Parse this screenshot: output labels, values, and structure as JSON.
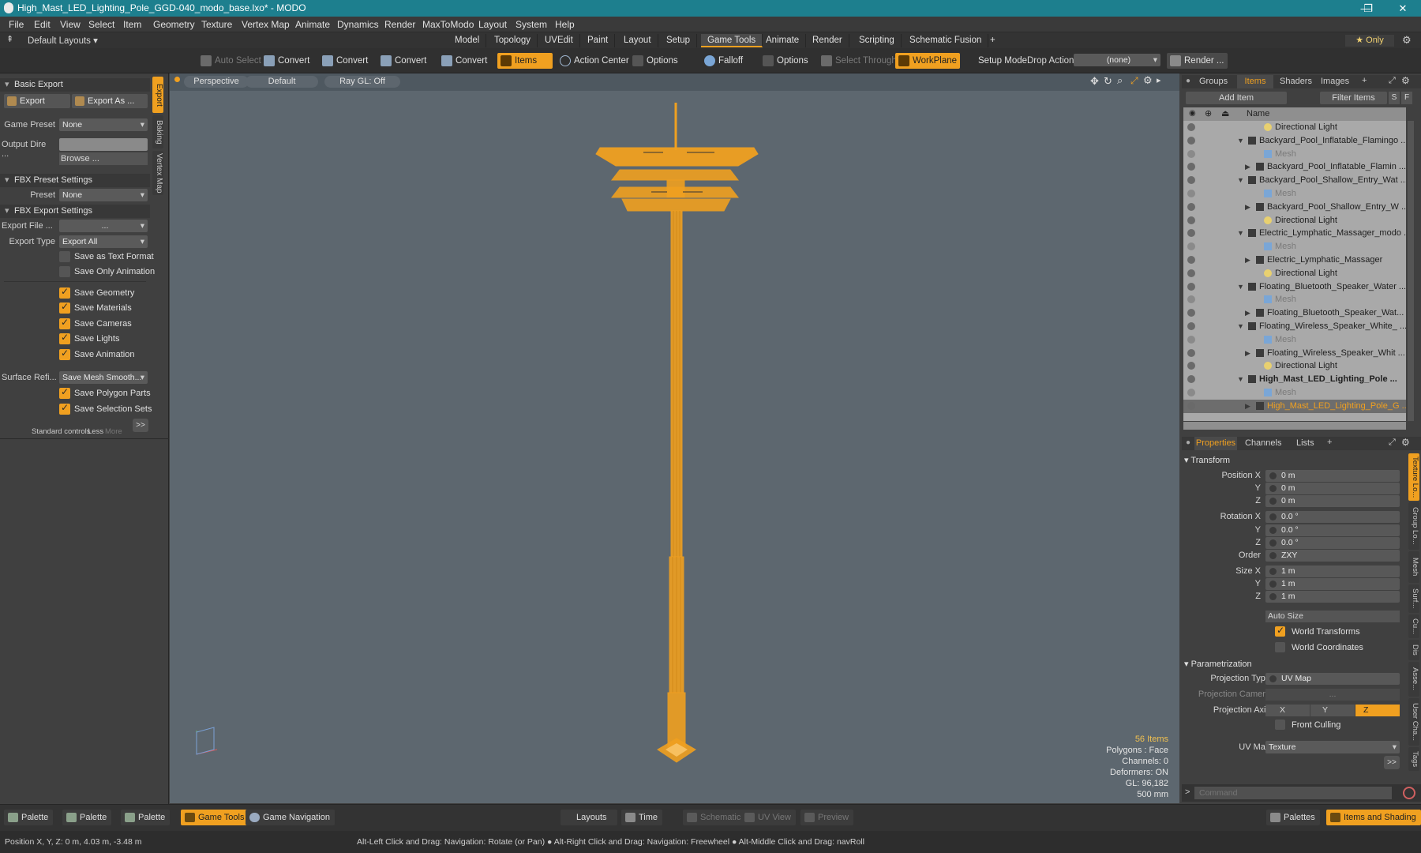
{
  "window": {
    "title": "High_Mast_LED_Lighting_Pole_GGD-040_modo_base.lxo* - MODO",
    "min": "—",
    "max": "❐",
    "close": "✕"
  },
  "menu": [
    "File",
    "Edit",
    "View",
    "Select",
    "Item",
    "Geometry",
    "Texture",
    "Vertex Map",
    "Animate",
    "Dynamics",
    "Render",
    "MaxToModo",
    "Layout",
    "System",
    "Help"
  ],
  "layouts_dropdown": "Default Layouts ▾",
  "tabs": [
    "Model",
    "Topology",
    "UVEdit",
    "Paint",
    "Layout",
    "Setup",
    "Game Tools",
    "Animate",
    "Render",
    "Scripting",
    "Schematic Fusion",
    "+"
  ],
  "active_tab": "Game Tools",
  "only_label": "★  Only",
  "toolbar": {
    "auto_select": "Auto Select",
    "convert1": "Convert",
    "convert2": "Convert",
    "convert3": "Convert",
    "convert4": "Convert",
    "items": "Items",
    "action_center": "Action Center",
    "options1": "Options",
    "falloff": "Falloff",
    "options2": "Options",
    "select_through": "Select Through",
    "workplane": "WorkPlane",
    "setup_mode": "Setup Mode",
    "drop_action": "Drop Action",
    "drop_value": "(none)",
    "render": "Render ..."
  },
  "left": {
    "basic_export": "Basic Export",
    "export_btn": "Export",
    "export_as_btn": "Export As ...",
    "game_preset_label": "Game Preset",
    "game_preset_value": "None",
    "output_dir_label": "Output Dire ...",
    "output_dir_value": "",
    "browse": "Browse ...",
    "fbx_preset_settings": "FBX Preset Settings",
    "preset_label": "Preset",
    "preset_value": "None",
    "fbx_export_settings": "FBX Export Settings",
    "export_file_label": "Export File  ...",
    "export_file_value": "...",
    "export_type_label": "Export Type",
    "export_type_value": "Export All",
    "save_as_text": "Save as Text Format",
    "save_only_anim": "Save Only Animation",
    "save_geometry": "Save Geometry",
    "save_materials": "Save Materials",
    "save_cameras": "Save Cameras",
    "save_lights": "Save Lights",
    "save_animation": "Save Animation",
    "surface_ref_label": "Surface Refi...",
    "surface_ref_value": "Save Mesh Smooth...",
    "save_polygon_parts": "Save Polygon Parts",
    "save_selection_sets": "Save Selection Sets",
    "standard_controls": "Standard controls",
    "less": "Less",
    "more": "More",
    "expand": ">>",
    "vtabs": [
      "Export",
      "Baking",
      "Vertex Map"
    ]
  },
  "viewport": {
    "view": "Perspective",
    "shading": "Default",
    "raygl": "Ray GL: Off",
    "stats": [
      "56 Items",
      "Polygons : Face",
      "Channels: 0",
      "Deformers: ON",
      "GL: 96,182",
      "500 mm"
    ]
  },
  "right": {
    "tabs": [
      "Groups",
      "Items",
      "Shaders",
      "Images"
    ],
    "add_item": "Add Item",
    "filter_items": "Filter Items",
    "col_name": "Name",
    "tree": [
      {
        "label": "Directional Light",
        "indent": 3,
        "type": "light"
      },
      {
        "label": "Backyard_Pool_Inflatable_Flamingo ...",
        "indent": 1,
        "type": "group"
      },
      {
        "label": "Mesh",
        "indent": 3,
        "type": "mesh"
      },
      {
        "label": "Backyard_Pool_Inflatable_Flamin ...",
        "indent": 2,
        "type": "item"
      },
      {
        "label": "Backyard_Pool_Shallow_Entry_Wat ...",
        "indent": 1,
        "type": "group"
      },
      {
        "label": "Mesh",
        "indent": 3,
        "type": "mesh"
      },
      {
        "label": "Backyard_Pool_Shallow_Entry_W ...",
        "indent": 2,
        "type": "item"
      },
      {
        "label": "Directional Light",
        "indent": 3,
        "type": "light"
      },
      {
        "label": "Electric_Lymphatic_Massager_modo ...",
        "indent": 1,
        "type": "group"
      },
      {
        "label": "Mesh",
        "indent": 3,
        "type": "mesh"
      },
      {
        "label": "Electric_Lymphatic_Massager",
        "indent": 2,
        "type": "item"
      },
      {
        "label": "Directional Light",
        "indent": 3,
        "type": "light"
      },
      {
        "label": "Floating_Bluetooth_Speaker_Water ...",
        "indent": 1,
        "type": "group"
      },
      {
        "label": "Mesh",
        "indent": 3,
        "type": "mesh"
      },
      {
        "label": "Floating_Bluetooth_Speaker_Wat...",
        "indent": 2,
        "type": "item"
      },
      {
        "label": "Floating_Wireless_Speaker_White_ ...",
        "indent": 1,
        "type": "group"
      },
      {
        "label": "Mesh",
        "indent": 3,
        "type": "mesh"
      },
      {
        "label": "Floating_Wireless_Speaker_Whit ...",
        "indent": 2,
        "type": "item"
      },
      {
        "label": "Directional Light",
        "indent": 3,
        "type": "light"
      },
      {
        "label": "High_Mast_LED_Lighting_Pole ...",
        "indent": 1,
        "type": "group",
        "bold": true
      },
      {
        "label": "Mesh",
        "indent": 3,
        "type": "mesh"
      },
      {
        "label": "High_Mast_LED_Lighting_Pole_G ...",
        "indent": 2,
        "type": "item",
        "selected": true
      }
    ],
    "prop_tabs": [
      "Properties",
      "Channels",
      "Lists",
      "+"
    ],
    "transform": "Transform",
    "position_x_label": "Position X",
    "y_label": "Y",
    "z_label": "Z",
    "pos": [
      "0 m",
      "0 m",
      "0 m"
    ],
    "rotation_x_label": "Rotation X",
    "rot": [
      "0.0 °",
      "0.0 °",
      "0.0 °"
    ],
    "order_label": "Order",
    "order": "ZXY",
    "size_x_label": "Size X",
    "size": [
      "1 m",
      "1 m",
      "1 m"
    ],
    "auto_size": "Auto Size",
    "world_transforms": "World Transforms",
    "world_coordinates": "World Coordinates",
    "parametrization": "Parametrization",
    "projection_type_label": "Projection Type",
    "projection_type": "UV Map",
    "projection_camera_label": "Projection Camera",
    "projection_camera": "...",
    "projection_axis_label": "Projection Axis",
    "axis": [
      "X",
      "Y",
      "Z"
    ],
    "front_culling": "Front Culling",
    "uv_map_label": "UV Map",
    "uv_map": "Texture",
    "expand": ">>",
    "side_tabs": [
      "Texture Lo...",
      "Group Lo...",
      "Mesh",
      "Surf...",
      "Cu...",
      "Dis",
      "Asse...",
      "User Cha...",
      "Tags"
    ],
    "command_placeholder": "Command"
  },
  "bottom": {
    "palettes": [
      "Palette",
      "Palette",
      "Palette"
    ],
    "game_tools": "Game Tools",
    "game_navigation": "Game Navigation",
    "layouts": "Layouts",
    "time": "Time",
    "schematic": "Schematic",
    "uv_view": "UV View",
    "preview": "Preview",
    "palettes_btn": "Palettes",
    "items_shading": "Items and Shading"
  },
  "status": {
    "position": "Position X, Y, Z:   0 m, 4.03 m, -3.48 m",
    "hint": "Alt-Left Click and Drag: Navigation: Rotate (or Pan) ● Alt-Right Click and Drag: Navigation: Freewheel ● Alt-Middle Click and Drag: navRoll"
  },
  "colors": {
    "accent": "#f0a020",
    "titlebar": "#1d7f8e",
    "viewport": "#5d676f",
    "tree_bg": "#a9a9a9",
    "selected_text": "#f0a020"
  }
}
